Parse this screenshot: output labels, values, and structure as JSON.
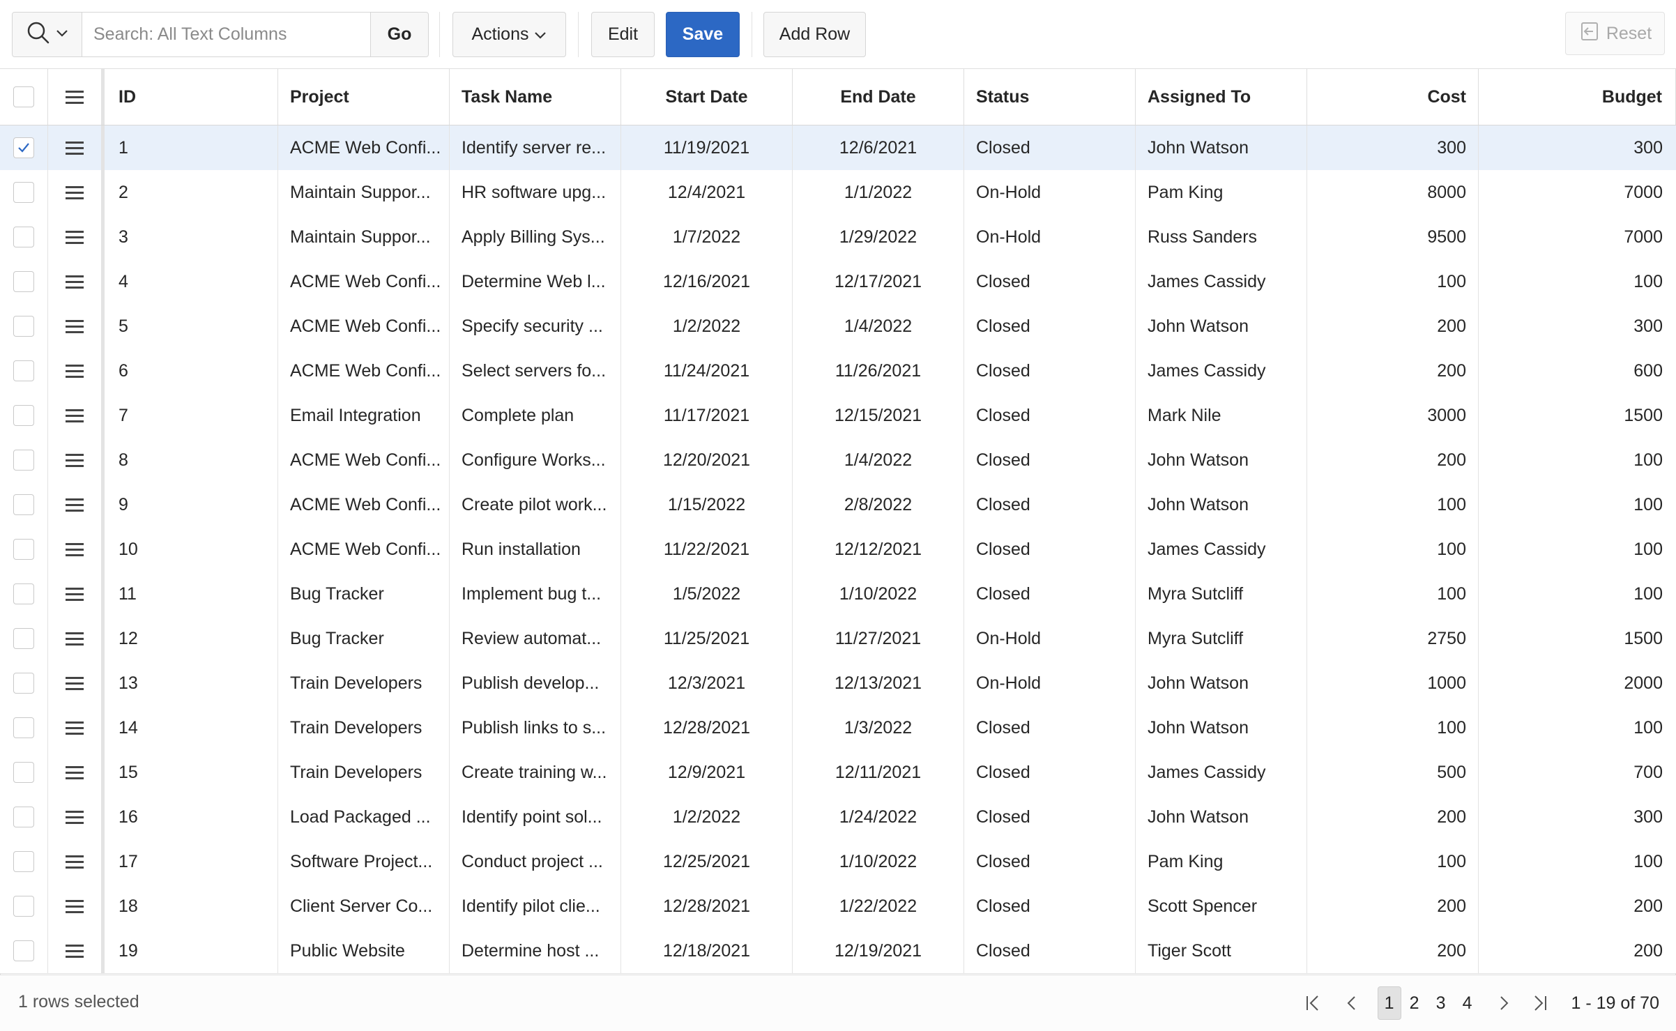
{
  "toolbar": {
    "search_placeholder": "Search: All Text Columns",
    "go_label": "Go",
    "actions_label": "Actions",
    "edit_label": "Edit",
    "save_label": "Save",
    "add_row_label": "Add Row",
    "reset_label": "Reset"
  },
  "grid": {
    "columns": [
      "ID",
      "Project",
      "Task Name",
      "Start Date",
      "End Date",
      "Status",
      "Assigned To",
      "Cost",
      "Budget"
    ],
    "rows": [
      {
        "id": "1",
        "project": "ACME Web Confi...",
        "task": "Identify server re...",
        "start": "11/19/2021",
        "end": "12/6/2021",
        "status": "Closed",
        "assigned": "John Watson",
        "cost": "300",
        "budget": "300",
        "selected": true
      },
      {
        "id": "2",
        "project": "Maintain Suppor...",
        "task": "HR software upg...",
        "start": "12/4/2021",
        "end": "1/1/2022",
        "status": "On-Hold",
        "assigned": "Pam King",
        "cost": "8000",
        "budget": "7000",
        "selected": false
      },
      {
        "id": "3",
        "project": "Maintain Suppor...",
        "task": "Apply Billing Sys...",
        "start": "1/7/2022",
        "end": "1/29/2022",
        "status": "On-Hold",
        "assigned": "Russ Sanders",
        "cost": "9500",
        "budget": "7000",
        "selected": false
      },
      {
        "id": "4",
        "project": "ACME Web Confi...",
        "task": "Determine Web l...",
        "start": "12/16/2021",
        "end": "12/17/2021",
        "status": "Closed",
        "assigned": "James Cassidy",
        "cost": "100",
        "budget": "100",
        "selected": false
      },
      {
        "id": "5",
        "project": "ACME Web Confi...",
        "task": "Specify security ...",
        "start": "1/2/2022",
        "end": "1/4/2022",
        "status": "Closed",
        "assigned": "John Watson",
        "cost": "200",
        "budget": "300",
        "selected": false
      },
      {
        "id": "6",
        "project": "ACME Web Confi...",
        "task": "Select servers fo...",
        "start": "11/24/2021",
        "end": "11/26/2021",
        "status": "Closed",
        "assigned": "James Cassidy",
        "cost": "200",
        "budget": "600",
        "selected": false
      },
      {
        "id": "7",
        "project": "Email Integration",
        "task": "Complete plan",
        "start": "11/17/2021",
        "end": "12/15/2021",
        "status": "Closed",
        "assigned": "Mark Nile",
        "cost": "3000",
        "budget": "1500",
        "selected": false
      },
      {
        "id": "8",
        "project": "ACME Web Confi...",
        "task": "Configure Works...",
        "start": "12/20/2021",
        "end": "1/4/2022",
        "status": "Closed",
        "assigned": "John Watson",
        "cost": "200",
        "budget": "100",
        "selected": false
      },
      {
        "id": "9",
        "project": "ACME Web Confi...",
        "task": "Create pilot work...",
        "start": "1/15/2022",
        "end": "2/8/2022",
        "status": "Closed",
        "assigned": "John Watson",
        "cost": "100",
        "budget": "100",
        "selected": false
      },
      {
        "id": "10",
        "project": "ACME Web Confi...",
        "task": "Run installation",
        "start": "11/22/2021",
        "end": "12/12/2021",
        "status": "Closed",
        "assigned": "James Cassidy",
        "cost": "100",
        "budget": "100",
        "selected": false
      },
      {
        "id": "11",
        "project": "Bug Tracker",
        "task": "Implement bug t...",
        "start": "1/5/2022",
        "end": "1/10/2022",
        "status": "Closed",
        "assigned": "Myra Sutcliff",
        "cost": "100",
        "budget": "100",
        "selected": false
      },
      {
        "id": "12",
        "project": "Bug Tracker",
        "task": "Review automat...",
        "start": "11/25/2021",
        "end": "11/27/2021",
        "status": "On-Hold",
        "assigned": "Myra Sutcliff",
        "cost": "2750",
        "budget": "1500",
        "selected": false
      },
      {
        "id": "13",
        "project": "Train Developers",
        "task": "Publish develop...",
        "start": "12/3/2021",
        "end": "12/13/2021",
        "status": "On-Hold",
        "assigned": "John Watson",
        "cost": "1000",
        "budget": "2000",
        "selected": false
      },
      {
        "id": "14",
        "project": "Train Developers",
        "task": "Publish links to s...",
        "start": "12/28/2021",
        "end": "1/3/2022",
        "status": "Closed",
        "assigned": "John Watson",
        "cost": "100",
        "budget": "100",
        "selected": false
      },
      {
        "id": "15",
        "project": "Train Developers",
        "task": "Create training w...",
        "start": "12/9/2021",
        "end": "12/11/2021",
        "status": "Closed",
        "assigned": "James Cassidy",
        "cost": "500",
        "budget": "700",
        "selected": false
      },
      {
        "id": "16",
        "project": "Load Packaged ...",
        "task": "Identify point sol...",
        "start": "1/2/2022",
        "end": "1/24/2022",
        "status": "Closed",
        "assigned": "John Watson",
        "cost": "200",
        "budget": "300",
        "selected": false
      },
      {
        "id": "17",
        "project": "Software Project...",
        "task": "Conduct project ...",
        "start": "12/25/2021",
        "end": "1/10/2022",
        "status": "Closed",
        "assigned": "Pam King",
        "cost": "100",
        "budget": "100",
        "selected": false
      },
      {
        "id": "18",
        "project": "Client Server Co...",
        "task": "Identify pilot clie...",
        "start": "12/28/2021",
        "end": "1/22/2022",
        "status": "Closed",
        "assigned": "Scott Spencer",
        "cost": "200",
        "budget": "200",
        "selected": false
      },
      {
        "id": "19",
        "project": "Public Website",
        "task": "Determine host ...",
        "start": "12/18/2021",
        "end": "12/19/2021",
        "status": "Closed",
        "assigned": "Tiger Scott",
        "cost": "200",
        "budget": "200",
        "selected": false
      }
    ]
  },
  "footer": {
    "selection_status": "1 rows selected",
    "pages": [
      "1",
      "2",
      "3",
      "4"
    ],
    "current_page": "1",
    "range": "1 - 19 of 70"
  },
  "colors": {
    "primary": "#2c68c4",
    "selected_row": "#e8f0fa",
    "border": "#e3e3e3"
  },
  "icons": {
    "search": "search-icon",
    "chevron": "chevron-down-icon",
    "row_actions": "hamburger-icon",
    "check": "checkmark-icon",
    "reset": "reset-icon",
    "first": "first-page-icon",
    "prev": "previous-page-icon",
    "next": "next-page-icon",
    "last": "last-page-icon"
  }
}
